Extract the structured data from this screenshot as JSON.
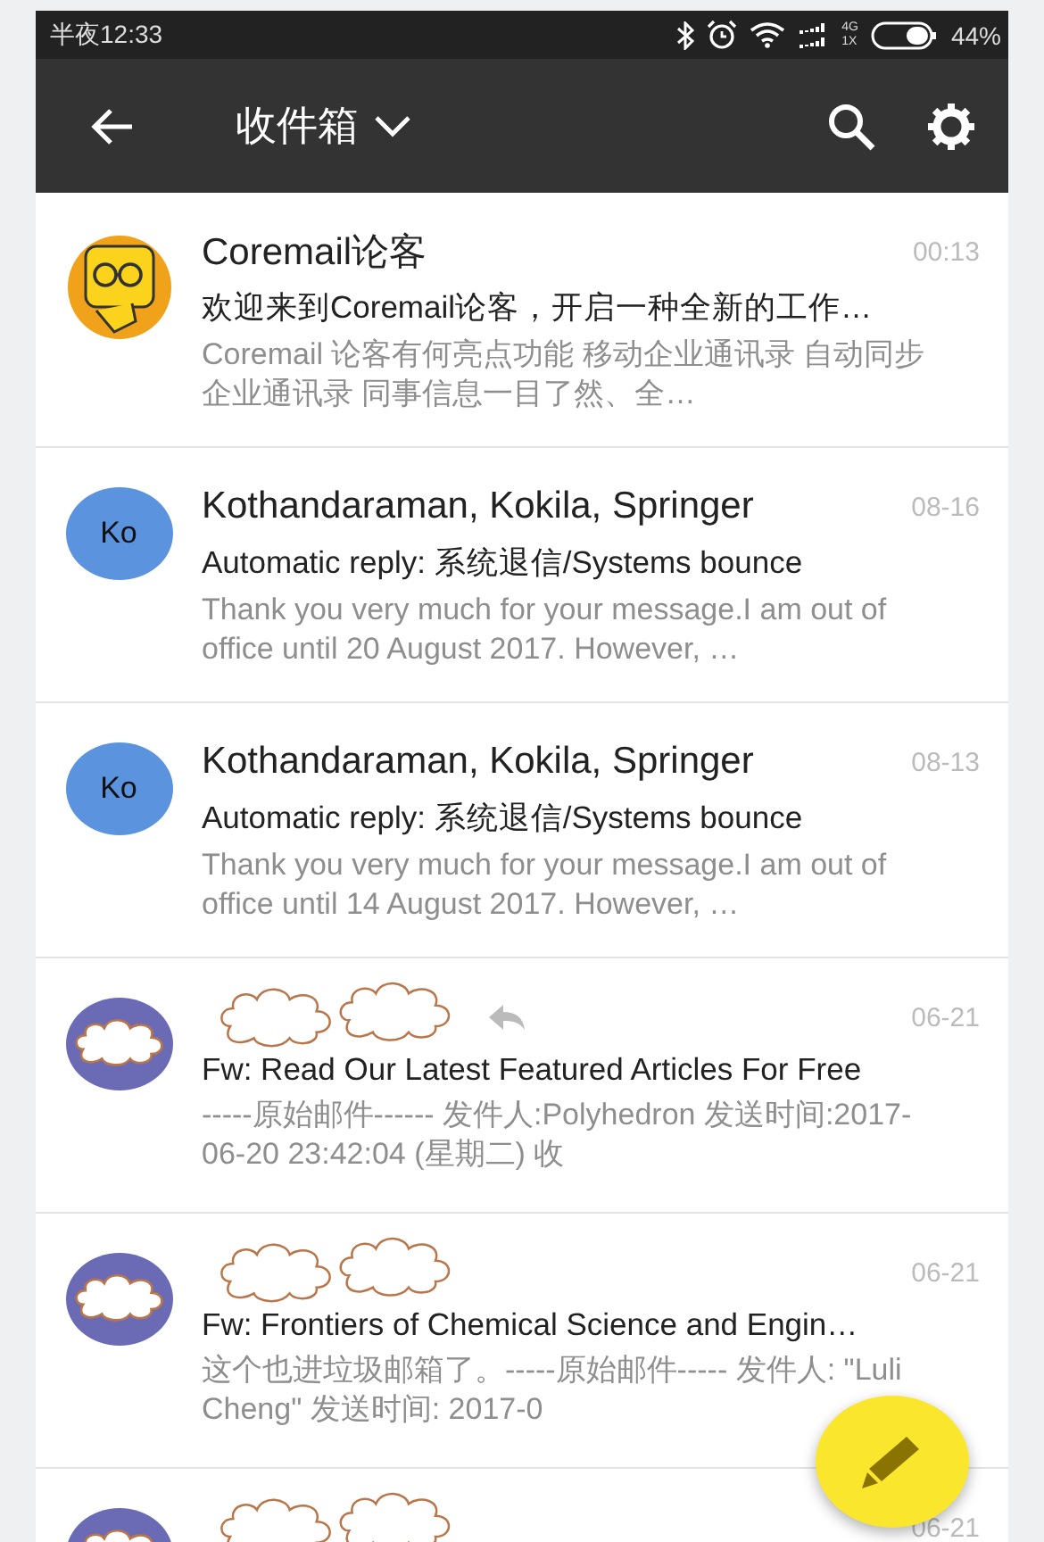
{
  "status_bar": {
    "time": "半夜12:33",
    "network_top": "4G",
    "network_bottom": "1X",
    "battery": "44%"
  },
  "app_bar": {
    "title": "收件箱"
  },
  "messages": [
    {
      "avatar": {
        "kind": "mascot"
      },
      "sender": "Coremail论客",
      "date": "00:13",
      "replied": false,
      "subject": "欢迎来到Coremail论客，开启一种全新的工作…",
      "preview": "Coremail 论客有何亮点功能 移动企业通讯录 自动同步企业通讯录 同事信息一目了然、全…"
    },
    {
      "avatar": {
        "kind": "initials",
        "text": "Ko",
        "color": "#5b93de"
      },
      "sender": "Kothandaraman, Kokila, Springer",
      "date": "08-16",
      "replied": false,
      "subject": "Automatic reply: 系统退信/Systems bounce",
      "preview": "Thank you very much for your message.I am out of office until 20 August 2017. However, …"
    },
    {
      "avatar": {
        "kind": "initials",
        "text": "Ko",
        "color": "#5b93de"
      },
      "sender": "Kothandaraman, Kokila, Springer",
      "date": "08-13",
      "replied": false,
      "subject": "Automatic reply: 系统退信/Systems bounce",
      "preview": "Thank you very much for your message.I am out of office until 14 August 2017. However, …"
    },
    {
      "avatar": {
        "kind": "redacted",
        "color": "#6b6bb5"
      },
      "date": "06-21",
      "replied": true,
      "subject": "Fw: Read Our Latest Featured Articles For Free",
      "preview": "-----原始邮件------ 发件人:Polyhedron   发送时间:2017-06-20 23:42:04 (星期二) 收"
    },
    {
      "avatar": {
        "kind": "redacted",
        "color": "#6b6bb5"
      },
      "date": "06-21",
      "replied": false,
      "subject": "Fw: Frontiers of Chemical Science and Engin…",
      "preview": "这个也进垃圾邮箱了。-----原始邮件----- 发件人: \"Luli Cheng\"  发送时间: 2017-0"
    },
    {
      "avatar": {
        "kind": "redacted",
        "color": "#6b6bb5"
      },
      "date": "06-21",
      "replied": false
    }
  ]
}
